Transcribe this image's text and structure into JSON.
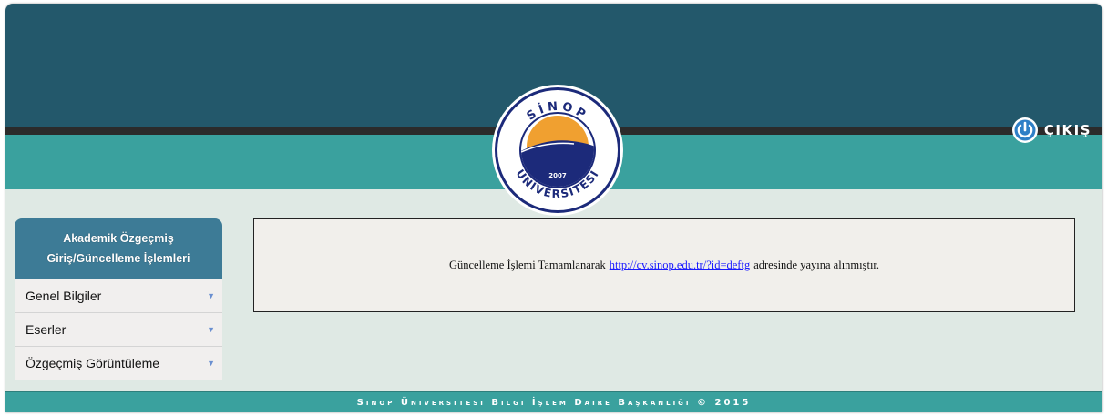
{
  "header": {
    "logo": {
      "top_text": "SİNOP",
      "year": "2007",
      "bottom_text": "ÜNİVERSİTESİ"
    },
    "logout_label": "ÇIKIŞ"
  },
  "sidebar": {
    "title_line1": "Akademik Özgeçmiş",
    "title_line2": "Giriş/Güncelleme İşlemleri",
    "items": [
      {
        "label": "Genel Bilgiler"
      },
      {
        "label": "Eserler"
      },
      {
        "label": "Özgeçmiş Görüntüleme"
      }
    ]
  },
  "content": {
    "message_before": "Güncelleme İşlemi Tamamlanarak",
    "link": "http://cv.sinop.edu.tr/?id=deftg",
    "message_after": "adresinde yayına alınmıştır."
  },
  "footer": {
    "text": "Sinop Üniversitesi Bilgi İşlem Daire Başkanlığı © 2015"
  },
  "colors": {
    "header_dark": "#23586b",
    "header_teal": "#3aa19e",
    "sidebar_head": "#3d7b96",
    "logo_navy": "#1c2a7a",
    "logo_sun": "#f0a030"
  }
}
